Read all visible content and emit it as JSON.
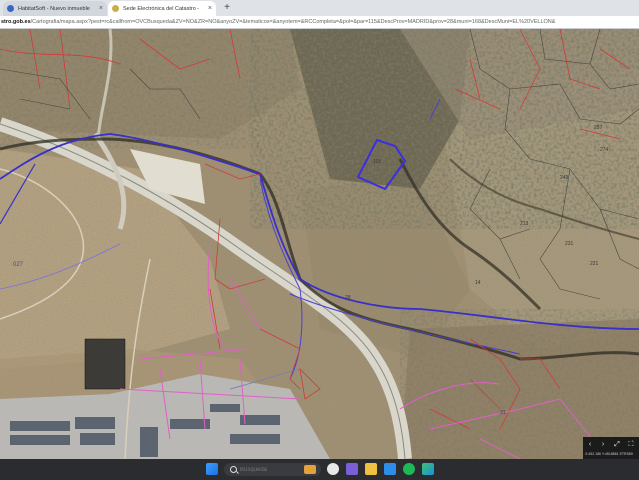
{
  "browser": {
    "tabs": [
      {
        "label": "HabitatSoft - Nuevo inmueble",
        "active": false,
        "icon": "habitatsoft-icon"
      },
      {
        "label": "Sede Electrónica del Catastro - ",
        "active": true,
        "icon": "catastro-icon"
      }
    ],
    "close_glyph": "×",
    "new_tab_glyph": "+",
    "url_host": "stro.gob.es",
    "url_path": "/Cartografia/mapa.aspx?pest=rc&callfrom=OVCBusqueda&ZV=NO&ZR=NO&anyoZV=&tematicos=&anyotem=&RCCompleta=&pol=&par=115&DescProv=MADRID&prov=28&muni=168&DescMuni=EL%20VELLON&"
  },
  "map": {
    "labels": [
      {
        "text": "027",
        "color": "#4a3cd0"
      },
      {
        "text": "28",
        "color": "#3a3a3a"
      },
      {
        "text": "257",
        "color": "#3a3a3a"
      },
      {
        "text": "249",
        "color": "#3a3a3a"
      },
      {
        "text": "274",
        "color": "#3a3a3a"
      },
      {
        "text": "231",
        "color": "#3a3a3a"
      },
      {
        "text": "221",
        "color": "#3a3a3a"
      },
      {
        "text": "213",
        "color": "#3a3a3a"
      },
      {
        "text": "14",
        "color": "#3a3a3a"
      },
      {
        "text": "31",
        "color": "#3a3a3a"
      },
      {
        "text": "115",
        "color": "#3a3a3a"
      }
    ],
    "colors": {
      "parcel_highlight": "#3b2fe0",
      "boundary_blue": "#3830c8",
      "parcel_red": "#d23a3a",
      "urban_pink": "#e060c8",
      "highway": "#d9d6cc"
    },
    "controls": {
      "prev_label": "‹",
      "next_label": "›",
      "zoom_label": "⤢",
      "fullscreen_label": "⛶",
      "coords": "X:452.186 Y:4518861 ETRS89"
    }
  },
  "taskbar": {
    "search_placeholder": "Búsqueda",
    "pinned": [
      "windows-start-icon",
      "chrome-icon",
      "mail-icon",
      "teams-icon",
      "file-explorer-icon",
      "store-icon",
      "spotify-icon",
      "edge-icon"
    ]
  }
}
